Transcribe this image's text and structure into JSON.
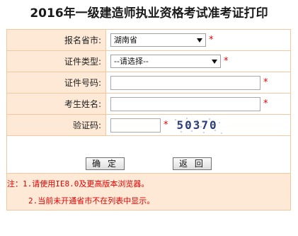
{
  "page": {
    "title": "2016年一级建造师执业资格考试准考证打印"
  },
  "form": {
    "province": {
      "label": "报名省市:",
      "value": "湖南省",
      "required_mark": "*"
    },
    "id_type": {
      "label": "证件类型:",
      "value": "--请选择--",
      "required_mark": "*"
    },
    "id_number": {
      "label": "证件号码:",
      "value": "",
      "required_mark": "*"
    },
    "name": {
      "label": "考生姓名:",
      "value": "",
      "required_mark": "*"
    },
    "captcha": {
      "label": "验证码:",
      "value": "",
      "required_mark": "*",
      "image_text": "50370"
    }
  },
  "buttons": {
    "confirm": "确 定",
    "back": "返 回"
  },
  "notes": {
    "line1": "注：1.请使用IE8.0及更高版本浏览器。",
    "line2": "2.当前未开通省市不在列表中显示。"
  },
  "colors": {
    "label_bg": "#fde9d6",
    "border": "#f0c9a0",
    "required": "#e60000",
    "note_text": "#e60000"
  }
}
